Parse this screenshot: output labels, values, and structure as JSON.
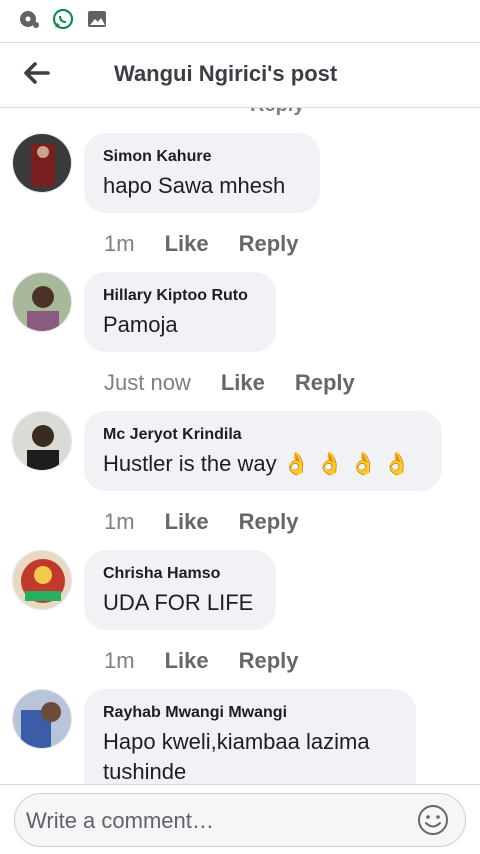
{
  "statusbar": {
    "icons": [
      "music-notification-icon",
      "whatsapp-icon",
      "gallery-icon"
    ]
  },
  "header": {
    "title": "Wangui Ngirici's post",
    "back_icon": "arrow-left-icon"
  },
  "feed": {
    "peek_text": "Reply"
  },
  "comments": [
    {
      "name": "Simon Kahure",
      "text": "hapo Sawa mhesh",
      "time": "1m",
      "like": "Like",
      "reply": "Reply",
      "avatar_color": "#7a1f1f"
    },
    {
      "name": "Hillary Kiptoo Ruto",
      "text": "Pamoja",
      "time": "Just now",
      "like": "Like",
      "reply": "Reply",
      "avatar_color": "#4a6a3a"
    },
    {
      "name": "Mc Jeryot Krindila",
      "text": "Hustler is the way",
      "time": "1m",
      "like": "Like",
      "reply": "Reply",
      "avatar_color": "#2a2a2a",
      "emoji": "👌 👌 👌 👌"
    },
    {
      "name": "Chrisha Hamso",
      "text": "UDA FOR LIFE",
      "time": "1m",
      "like": "Like",
      "reply": "Reply",
      "avatar_color": "#c0392b"
    },
    {
      "name": "Rayhab Mwangi Mwangi",
      "text": "Hapo kweli,kiambaa lazima tushinde",
      "avatar_color": "#3b5da8"
    }
  ],
  "composer": {
    "placeholder": "Write a comment…",
    "emoji_icon": "smiley-icon"
  },
  "colors": {
    "bubble": "#f0f2f5",
    "secondary_text": "#65676b",
    "whatsapp": "#25d366"
  }
}
